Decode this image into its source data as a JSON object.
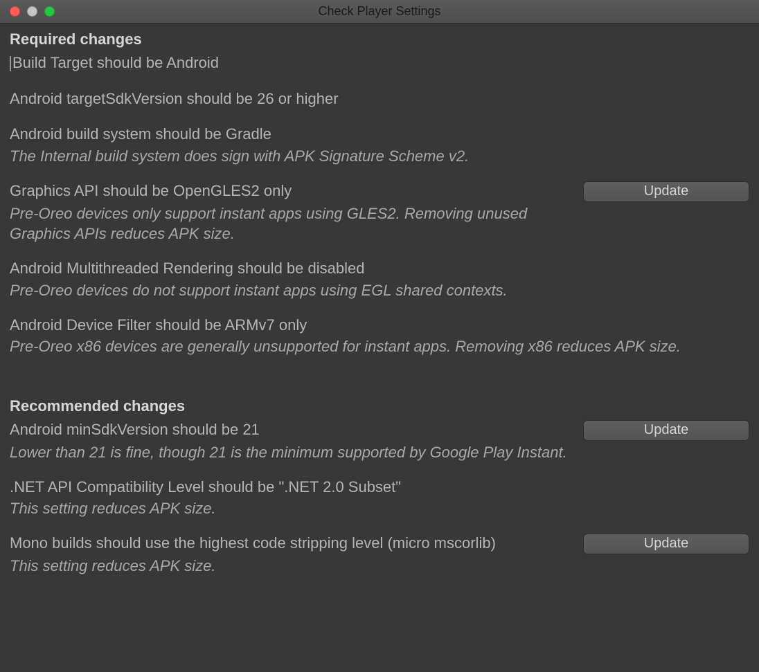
{
  "window": {
    "title": "Check Player Settings"
  },
  "buttons": {
    "update": "Update"
  },
  "sections": {
    "required": {
      "heading": "Required changes",
      "items": [
        {
          "title": "Build Target should be Android",
          "desc": null,
          "has_button": false
        },
        {
          "title": "Android targetSdkVersion should be 26 or higher",
          "desc": null,
          "has_button": false
        },
        {
          "title": "Android build system should be Gradle",
          "desc": "The Internal build system does sign with APK Signature Scheme v2.",
          "has_button": false
        },
        {
          "title": "Graphics API should be OpenGLES2 only",
          "desc": "Pre-Oreo devices only support instant apps using GLES2. Removing unused Graphics APIs reduces APK size.",
          "has_button": true
        },
        {
          "title": "Android Multithreaded Rendering should be disabled",
          "desc": "Pre-Oreo devices do not support instant apps using EGL shared contexts.",
          "has_button": false
        },
        {
          "title": "Android Device Filter should be ARMv7 only",
          "desc": "Pre-Oreo x86 devices are generally unsupported for instant apps. Removing x86 reduces APK size.",
          "has_button": false
        }
      ]
    },
    "recommended": {
      "heading": "Recommended changes",
      "items": [
        {
          "title": "Android minSdkVersion should be 21",
          "desc": "Lower than 21 is fine, though 21 is the minimum supported by Google Play Instant.",
          "has_button": true
        },
        {
          "title": ".NET API Compatibility Level should be \".NET 2.0 Subset\"",
          "desc": "This setting reduces APK size.",
          "has_button": false
        },
        {
          "title": "Mono builds should use the highest code stripping level (micro mscorlib)",
          "desc": "This setting reduces APK size.",
          "has_button": true
        }
      ]
    }
  }
}
